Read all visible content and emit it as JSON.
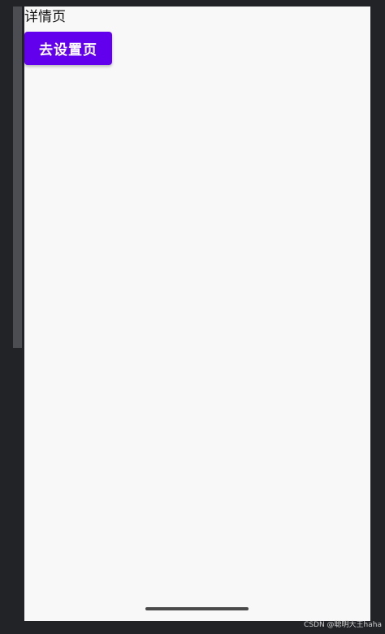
{
  "page": {
    "title": "详情页"
  },
  "status_bar": {
    "left_text": "",
    "right_text": ""
  },
  "actions": {
    "go_settings_label": "去设置页"
  },
  "watermark": {
    "text": "CSDN @聪明大王haha"
  },
  "colors": {
    "button_bg": "#6200ee",
    "screen_bg": "#f8f8f8",
    "outer_bg": "#212327"
  }
}
